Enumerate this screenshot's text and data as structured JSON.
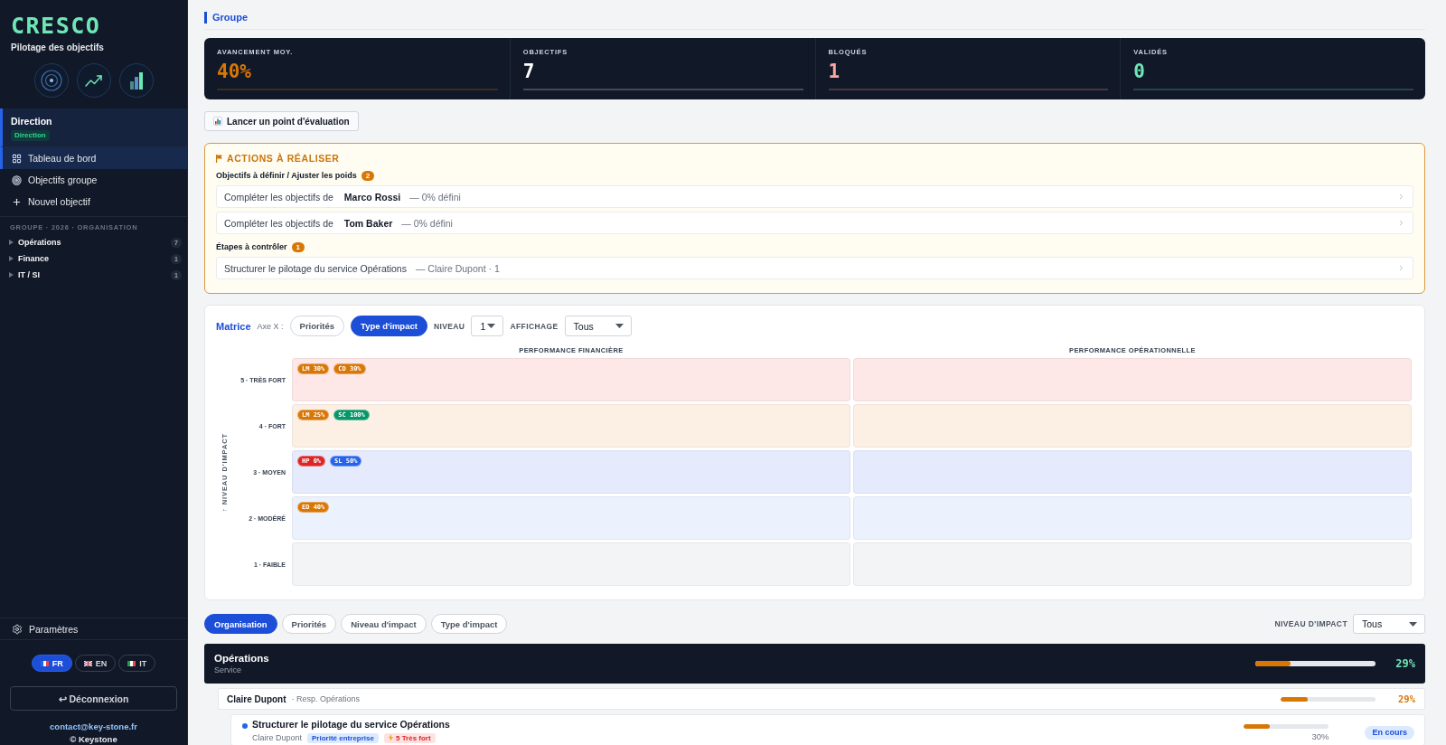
{
  "sidebar": {
    "brand": "CRESCO",
    "tagline": "Pilotage des objectifs",
    "profile": {
      "name": "Direction",
      "role": "Direction"
    },
    "nav": [
      {
        "label": "Tableau de bord",
        "kind": "dashboard",
        "selected": true
      },
      {
        "label": "Objectifs groupe",
        "kind": "goals",
        "selected": false
      },
      {
        "label": "Nouvel objectif",
        "kind": "add",
        "selected": false
      }
    ],
    "tree_title": "GROUPE · 2026 · ORGANISATION",
    "tree": [
      {
        "label": "Opérations",
        "count": "7",
        "expanded": false
      },
      {
        "label": "Finance",
        "count": "1",
        "expanded": false
      },
      {
        "label": "IT / SI",
        "count": "1",
        "expanded": false
      }
    ],
    "settings": "Paramètres",
    "languages": [
      {
        "code": "FR",
        "kind": "fr",
        "selected": true
      },
      {
        "code": "EN",
        "kind": "gb",
        "selected": false
      },
      {
        "code": "IT",
        "kind": "it",
        "selected": false
      }
    ],
    "logout": "↩ Déconnexion",
    "contact": "contact@key-stone.fr",
    "copyright": "© Keystone"
  },
  "breadcrumb": "Groupe",
  "stats": [
    {
      "label": "AVANCEMENT MOY.",
      "value": "40%",
      "color": "#d97706"
    },
    {
      "label": "OBJECTIFS",
      "value": "7",
      "color": "#ffffff"
    },
    {
      "label": "BLOQUÉS",
      "value": "1",
      "color": "#fca5a5"
    },
    {
      "label": "VALIDÉS",
      "value": "0",
      "color": "#6ee7b7"
    }
  ],
  "evaluation_button": "Lancer un point d'évaluation",
  "actions": {
    "title": "ACTIONS À RÉALISER",
    "groups": [
      {
        "title": "Objectifs à définir / Ajuster les poids",
        "count": "2",
        "items": [
          {
            "text": "Compléter les objectifs de",
            "name": "Marco Rossi",
            "detail": "— 0% défini"
          },
          {
            "text": "Compléter les objectifs de",
            "name": "Tom Baker",
            "detail": "— 0% défini"
          }
        ]
      },
      {
        "title": "Étapes à contrôler",
        "count": "1",
        "items": [
          {
            "text": "Structurer le pilotage du service Opérations",
            "detail": "— Claire Dupont · 1"
          }
        ]
      }
    ]
  },
  "matrix": {
    "title": "Matrice",
    "axis_label": "Axe X :",
    "axis_options": [
      {
        "label": "Priorités",
        "selected": false
      },
      {
        "label": "Type d'impact",
        "selected": true
      }
    ],
    "level_label": "NIVEAU",
    "level_value": "1",
    "display_label": "AFFICHAGE",
    "display_value": "Tous",
    "y_axis_title": "↑ NIVEAU D'IMPACT",
    "columns": [
      "PERFORMANCE FINANCIÈRE",
      "PERFORMANCE OPÉRATIONNELLE"
    ],
    "rows": [
      {
        "label": "5 · TRÈS FORT",
        "color": "#fde7e7",
        "cells": [
          {
            "chips": [
              {
                "label": "LM 30%",
                "color": "#d97706"
              },
              {
                "label": "CD 30%",
                "color": "#d97706"
              }
            ]
          },
          {}
        ]
      },
      {
        "label": "4 · FORT",
        "color": "#fcefe4",
        "cells": [
          {
            "chips": [
              {
                "label": "LM 25%",
                "color": "#d97706"
              },
              {
                "label": "SC 100%",
                "color": "#059669"
              }
            ]
          },
          {}
        ]
      },
      {
        "label": "3 · MOYEN",
        "color": "#e5eafc",
        "cells": [
          {
            "chips": [
              {
                "label": "HP 0%",
                "color": "#dc2626"
              },
              {
                "label": "SL 50%",
                "color": "#2563eb"
              }
            ]
          },
          {}
        ]
      },
      {
        "label": "2 · MODÉRÉ",
        "color": "#ebf1fd",
        "cells": [
          {
            "chips": [
              {
                "label": "ED 40%",
                "color": "#d97706"
              }
            ]
          },
          {}
        ]
      },
      {
        "label": "1 · FAIBLE",
        "color": "#f3f4f6",
        "cells": [
          {},
          {}
        ]
      }
    ]
  },
  "view_tabs": [
    {
      "label": "Organisation",
      "selected": true
    },
    {
      "label": "Priorités",
      "selected": false
    },
    {
      "label": "Niveau d'impact",
      "selected": false
    },
    {
      "label": "Type d'impact",
      "selected": false
    }
  ],
  "impact_filter": {
    "label": "NIVEAU D'IMPACT",
    "value": "Tous"
  },
  "services": [
    {
      "name": "Opérations",
      "type": "Service",
      "level": 0.29,
      "reading": "29%",
      "people": [
        {
          "name": "Claire Dupont",
          "role": "· Resp. Opérations",
          "level": 0.29,
          "reading": "29%",
          "objectives": [
            {
              "title": "Structurer le pilotage du service Opérations",
              "owner": "Claire Dupont",
              "tags": [
                {
                  "kind": "priority",
                  "label": "Priorité entreprise"
                },
                {
                  "kind": "impact",
                  "label": "5 Très fort"
                }
              ],
              "level": 0.3,
              "reading": "30%",
              "status": "En cours"
            }
          ]
        }
      ]
    }
  ]
}
